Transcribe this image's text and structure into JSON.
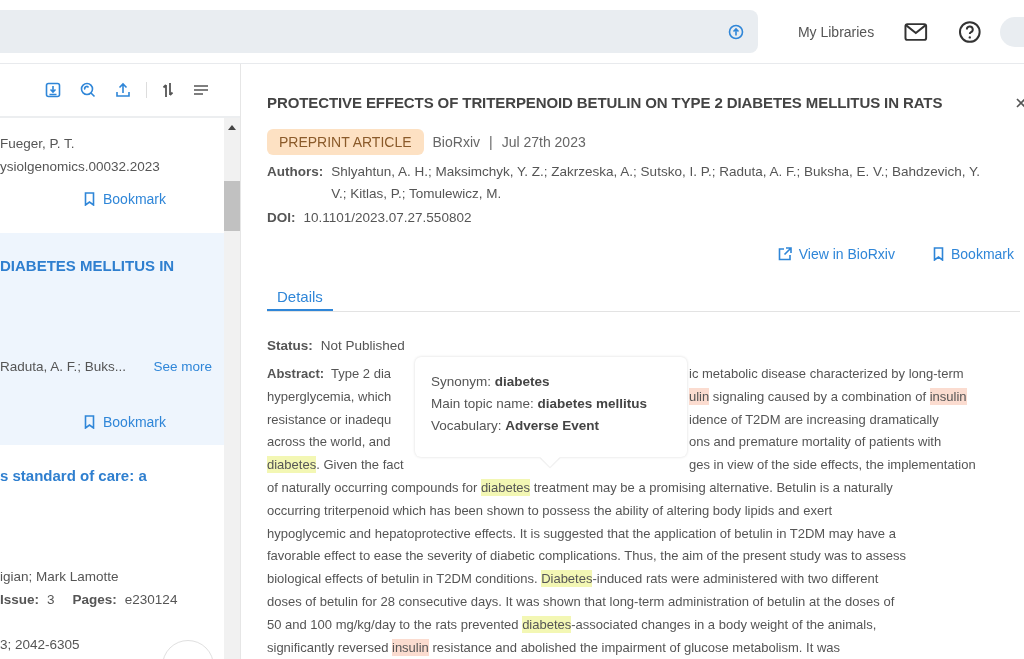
{
  "topbar": {
    "libraries": "My Libraries"
  },
  "results": [
    {
      "selected": false,
      "lines": [
        "Fueger, P. T.",
        "ysiolgenomics.00032.2023"
      ],
      "bookmark": "Bookmark"
    },
    {
      "selected": true,
      "title": "DIABETES MELLITUS IN",
      "authors": "Raduta, A. F.; Buks...",
      "see_more": "See more",
      "bookmark": "Bookmark"
    },
    {
      "selected": false,
      "title": "s standard of care: a",
      "authors": "igian; Mark Lamotte",
      "issue_label": "Issue:",
      "issue": "3",
      "pages_label": "Pages:",
      "pages": "e230124",
      "issn": "3; 2042-6305"
    }
  ],
  "article": {
    "title": "PROTECTIVE EFFECTS OF TRITERPENOID BETULIN ON TYPE 2 DIABETES MELLITUS IN RATS",
    "badge": "PREPRINT ARTICLE",
    "source": "BioRxiv",
    "separator": "|",
    "date": "Jul 27th 2023",
    "authors_label": "Authors:",
    "authors": [
      "Shlyahtun, A. H.; Maksimchyk, Y. Z.; Zakrzeska, A.; Sutsko, I. P.; Raduta, A. F.; Buksha, E. V.; Bahdzevich, Y.",
      "V.; Kitlas, P.; Tomulewicz, M."
    ],
    "doi_label": "DOI:",
    "doi": "10.1101/2023.07.27.550802",
    "view_link": "View in BioRxiv",
    "bookmark": "Bookmark",
    "tabs": [
      {
        "label": "Details",
        "selected": true
      }
    ],
    "status_label": "Status:",
    "status": "Not Published",
    "abstract_label": "Abstract:",
    "abstract_lines": [
      {
        "left": [
          {
            "text": "Type 2 dia"
          }
        ],
        "right": [
          {
            "text": "ic metabolic disease characterized by long-term"
          }
        ]
      },
      {
        "left": [
          {
            "text": "hyperglycemia, which"
          }
        ],
        "right": [
          {
            "text": "ulin",
            "color": "#fbdcd0"
          },
          {
            "text": " signaling caused by a combination of "
          },
          {
            "text": "insulin",
            "color": "#fbdcd0"
          }
        ]
      },
      {
        "left": [
          {
            "text": "resistance or inadequ"
          }
        ],
        "right": [
          {
            "text": "idence of T2DM are increasing dramatically"
          }
        ]
      },
      {
        "left": [
          {
            "text": "across the world, and"
          }
        ],
        "right": [
          {
            "text": "ons and premature mortality of patients with"
          }
        ]
      },
      {
        "left": [
          {
            "text": "diabetes",
            "color": "#f3f7b4"
          },
          {
            "text": ". Given the fact"
          }
        ],
        "right": [
          {
            "text": "ges in view of the side effects, the implementation"
          }
        ]
      },
      {
        "left": [
          {
            "text": "of naturally occurring compounds for "
          },
          {
            "text": "diabetes",
            "color": "#f3f7b4"
          },
          {
            "text": " treatment may be a promising alternative. Betulin is a naturally"
          }
        ]
      },
      {
        "left": [
          {
            "text": "occurring triterpenoid which has been shown to possess the ability of altering body lipids and exert"
          }
        ]
      },
      {
        "left": [
          {
            "text": "hypoglycemic and hepatoprotective effects. It is suggested that the application of betulin in T2DM may have a"
          }
        ]
      },
      {
        "left": [
          {
            "text": "favorable effect to ease the severity of diabetic complications. Thus, the aim of the present study was to assess"
          }
        ]
      },
      {
        "left": [
          {
            "text": "biological effects of betulin in T2DM conditions. "
          },
          {
            "text": "Diabetes",
            "color": "#f3f7b4"
          },
          {
            "text": "-induced rats were administered with two different"
          }
        ]
      },
      {
        "left": [
          {
            "text": "doses of betulin for 28 consecutive days. It was shown that long-term administration of betulin at the doses of"
          }
        ]
      },
      {
        "left": [
          {
            "text": "50 and 100 mg/kg/day to the rats prevented "
          },
          {
            "text": "diabetes",
            "color": "#f3f7b4"
          },
          {
            "text": "-associated changes in a body weight of the animals,"
          }
        ]
      },
      {
        "left": [
          {
            "text": "significantly reversed "
          },
          {
            "text": "insulin",
            "color": "#fbdcd0"
          },
          {
            "text": " resistance and abolished the impairment of glucose metabolism. It was"
          }
        ]
      }
    ],
    "tooltip": [
      {
        "label": "Synonym:",
        "value": "diabetes"
      },
      {
        "label": "Main topic name:",
        "value": "diabetes mellitus"
      },
      {
        "label": "Vocabulary:",
        "value": "Adverse Event"
      }
    ]
  }
}
